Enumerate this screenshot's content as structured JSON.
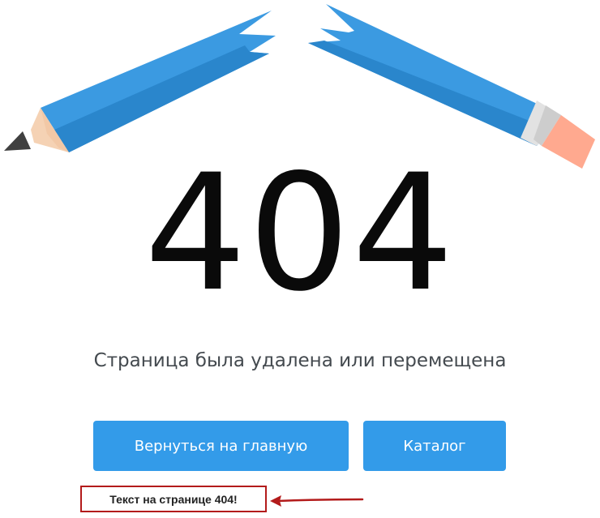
{
  "error": {
    "code": "404",
    "message": "Страница была удалена или перемещена"
  },
  "actions": {
    "home_label": "Вернуться на главную",
    "catalog_label": "Каталог"
  },
  "annotation": {
    "label": "Текст на странице 404!"
  },
  "illustration": {
    "icon": "broken-pencil-icon"
  },
  "colors": {
    "accent": "#339be9",
    "pencil_blue": "#3b9ae1",
    "annotation_red": "#b31b1b",
    "text_dark": "#0a0a0a",
    "message_text": "#444a4f"
  }
}
